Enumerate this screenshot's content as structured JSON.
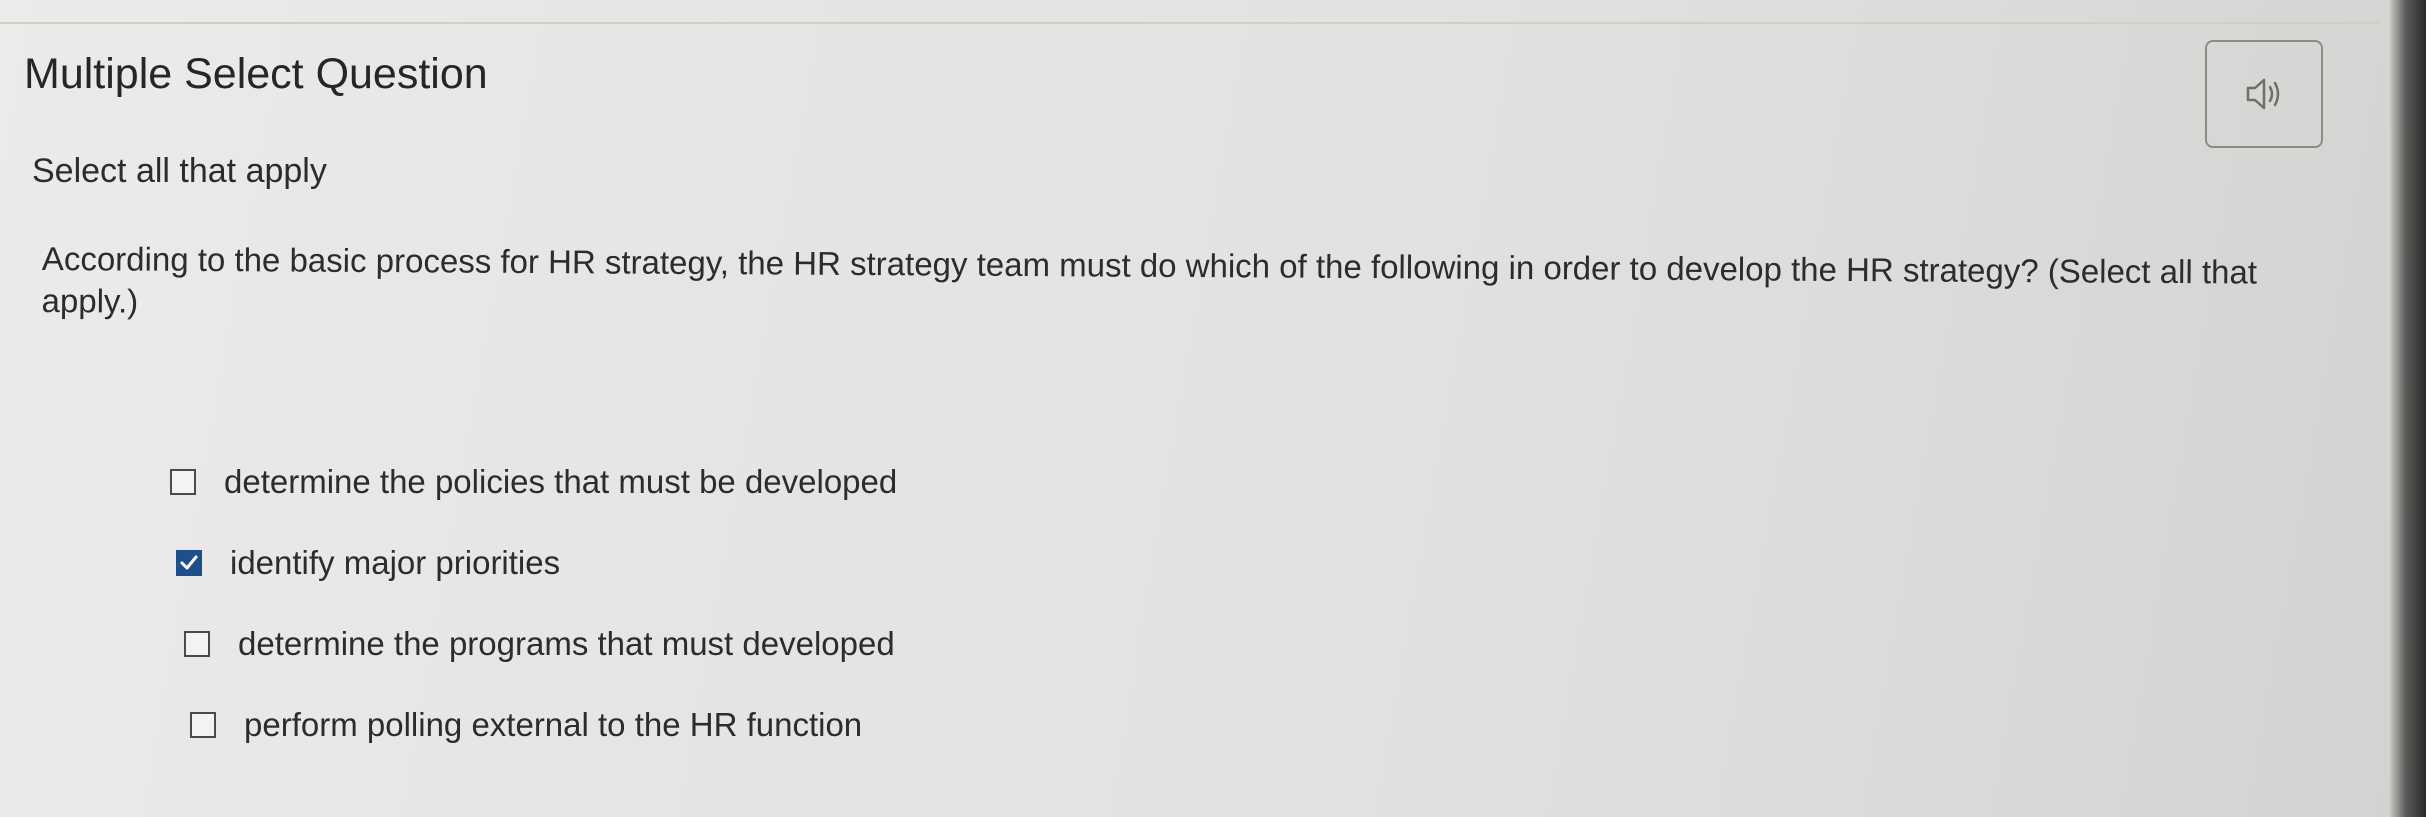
{
  "header": {
    "title": "Multiple Select Question"
  },
  "audio_button": {
    "icon": "speaker-icon"
  },
  "instructions": "Select all that apply",
  "question": "According to the basic process for HR strategy, the HR strategy team must do which of the following in order to develop the HR strategy? (Select all that apply.)",
  "options": [
    {
      "label": "determine the policies that must be developed",
      "checked": false
    },
    {
      "label": "identify major priorities",
      "checked": true
    },
    {
      "label": "determine the programs that must developed",
      "checked": false
    },
    {
      "label": "perform polling external to the HR function",
      "checked": false
    }
  ],
  "colors": {
    "checkbox_checked": "#1f4e8c",
    "text": "#2c2c2c"
  }
}
